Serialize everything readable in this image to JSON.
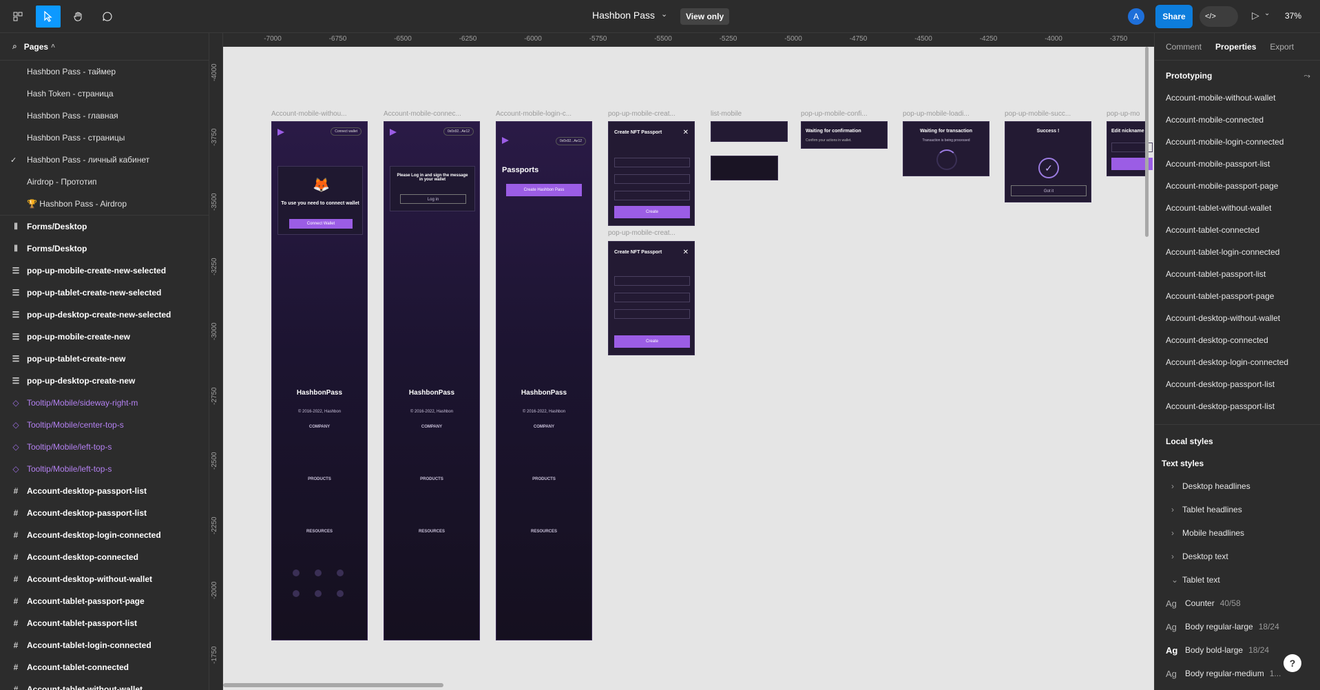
{
  "topbar": {
    "title": "Hashbon Pass",
    "view_only": "View only",
    "avatar": "A",
    "share": "Share",
    "dev_icon": "</>",
    "zoom": "37%"
  },
  "left_panel": {
    "pages_label": "Pages",
    "pages": [
      "Hashbon Pass - таймер",
      "Hash Token - страница",
      "Hashbon Pass - главная",
      "Hashbon Pass - страницы",
      "Hashbon Pass - личный кабинет",
      "Airdrop - Прототип",
      "🏆 Hashbon Pass - Airdrop"
    ],
    "active_page_index": 4,
    "layers": [
      {
        "label": "Forms/Desktop",
        "icon": "bars-icon",
        "glyph": "⫴",
        "style": "normal"
      },
      {
        "label": "Forms/Desktop",
        "icon": "bars-icon",
        "glyph": "⫴",
        "style": "normal"
      },
      {
        "label": "pop-up-mobile-create-new-selected",
        "icon": "lines-icon",
        "glyph": "☰",
        "style": "normal"
      },
      {
        "label": "pop-up-tablet-create-new-selected",
        "icon": "lines-icon",
        "glyph": "☰",
        "style": "normal"
      },
      {
        "label": "pop-up-desktop-create-new-selected",
        "icon": "lines-icon",
        "glyph": "☰",
        "style": "normal"
      },
      {
        "label": "pop-up-mobile-create-new",
        "icon": "lines-icon",
        "glyph": "☰",
        "style": "normal"
      },
      {
        "label": "pop-up-tablet-create-new",
        "icon": "lines-icon",
        "glyph": "☰",
        "style": "normal"
      },
      {
        "label": "pop-up-desktop-create-new",
        "icon": "lines-icon",
        "glyph": "☰",
        "style": "normal"
      },
      {
        "label": "Tooltip/Mobile/sideway-right-m",
        "icon": "component-icon",
        "glyph": "◇",
        "style": "purple"
      },
      {
        "label": "Tooltip/Mobile/center-top-s",
        "icon": "component-icon",
        "glyph": "◇",
        "style": "purple"
      },
      {
        "label": "Tooltip/Mobile/left-top-s",
        "icon": "component-icon",
        "glyph": "◇",
        "style": "purple"
      },
      {
        "label": "Tooltip/Mobile/left-top-s",
        "icon": "component-icon",
        "glyph": "◇",
        "style": "purple"
      },
      {
        "label": "Account-desktop-passport-list",
        "icon": "frame-icon",
        "glyph": "#",
        "style": "normal"
      },
      {
        "label": "Account-desktop-passport-list",
        "icon": "frame-icon",
        "glyph": "#",
        "style": "normal"
      },
      {
        "label": "Account-desktop-login-connected",
        "icon": "frame-icon",
        "glyph": "#",
        "style": "normal"
      },
      {
        "label": "Account-desktop-connected",
        "icon": "frame-icon",
        "glyph": "#",
        "style": "normal"
      },
      {
        "label": "Account-desktop-without-wallet",
        "icon": "frame-icon",
        "glyph": "#",
        "style": "normal"
      },
      {
        "label": "Account-tablet-passport-page",
        "icon": "frame-icon",
        "glyph": "#",
        "style": "normal"
      },
      {
        "label": "Account-tablet-passport-list",
        "icon": "frame-icon",
        "glyph": "#",
        "style": "normal"
      },
      {
        "label": "Account-tablet-login-connected",
        "icon": "frame-icon",
        "glyph": "#",
        "style": "normal"
      },
      {
        "label": "Account-tablet-connected",
        "icon": "frame-icon",
        "glyph": "#",
        "style": "normal"
      },
      {
        "label": "Account-tablet-without-wallet",
        "icon": "frame-icon",
        "glyph": "#",
        "style": "normal"
      }
    ]
  },
  "canvas": {
    "ruler_x": [
      "-7000",
      "-6750",
      "-6500",
      "-6250",
      "-6000",
      "-5750",
      "-5500",
      "-5250",
      "-5000",
      "-4750",
      "-4500",
      "-4250",
      "-4000",
      "-3750"
    ],
    "ruler_y": [
      "-4000",
      "-3750",
      "-3500",
      "-3250",
      "-3000",
      "-2750",
      "-2500",
      "-2250",
      "-2000",
      "-1750"
    ],
    "frame_labels": [
      "Account-mobile-withou...",
      "Account-mobile-connec...",
      "Account-mobile-login-c...",
      "pop-up-mobile-creat...",
      "list-mobile",
      "pop-up-mobile-confi...",
      "pop-up-mobile-loadi...",
      "pop-up-mobile-succ...",
      "pop-up-mo",
      "pop-up-mobile-creat..."
    ],
    "frames": {
      "f1_pill": "Connect wallet",
      "f1_text": "To use you need to connect wallet",
      "f1_btn": "Connect Wallet",
      "f2_pill": "0x0x92...Ae12",
      "f2_text": "Please Log in and sign the message in your wallet",
      "f2_btn": "Log in",
      "f3_pill": "0x0x92...Ae12",
      "f3_title": "Passports",
      "f3_btn": "Create Hashbon Pass",
      "brand": "HashbonPass",
      "footer_lines": [
        "COMPANY",
        "PRODUCTS",
        "RESOURCES"
      ],
      "copyright": "© 2016-2022, Hashbon"
    },
    "popups": {
      "create_title": "Create NFT Passport",
      "create_btn": "Create",
      "confirm_title": "Waiting for confirmation",
      "confirm_sub": "Confirm your actions in wallet.",
      "loading_title": "Waiting for transaction",
      "loading_sub": "Transaction is being processed",
      "success_title": "Success !",
      "success_btn": "Got it",
      "edit_title": "Edit nickname"
    }
  },
  "right_panel": {
    "tabs": [
      "Comment",
      "Properties",
      "Export"
    ],
    "active_tab": 1,
    "prototyping_label": "Prototyping",
    "flows": [
      "Account-mobile-without-wallet",
      "Account-mobile-connected",
      "Account-mobile-login-connected",
      "Account-mobile-passport-list",
      "Account-mobile-passport-page",
      "Account-tablet-without-wallet",
      "Account-tablet-connected",
      "Account-tablet-login-connected",
      "Account-tablet-passport-list",
      "Account-tablet-passport-page",
      "Account-desktop-without-wallet",
      "Account-desktop-connected",
      "Account-desktop-login-connected",
      "Account-desktop-passport-list",
      "Account-desktop-passport-list"
    ],
    "local_styles": "Local styles",
    "text_styles": "Text styles",
    "style_groups": [
      "Desktop headlines",
      "Tablet headlines",
      "Mobile headlines",
      "Desktop text",
      "Tablet text"
    ],
    "tablet_text_items": [
      {
        "name": "Counter",
        "spec": "40/58",
        "bold": false
      },
      {
        "name": "Body regular-large",
        "spec": "18/24",
        "bold": false
      },
      {
        "name": "Body bold-large",
        "spec": "18/24",
        "bold": true
      },
      {
        "name": "Body regular-medium",
        "spec": "1...",
        "bold": false
      }
    ]
  },
  "colors": {
    "accent": "#0d99ff",
    "brand_purple": "#9b5de5",
    "canvas_bg": "#e5e5e5",
    "panel_bg": "#2c2c2c"
  }
}
